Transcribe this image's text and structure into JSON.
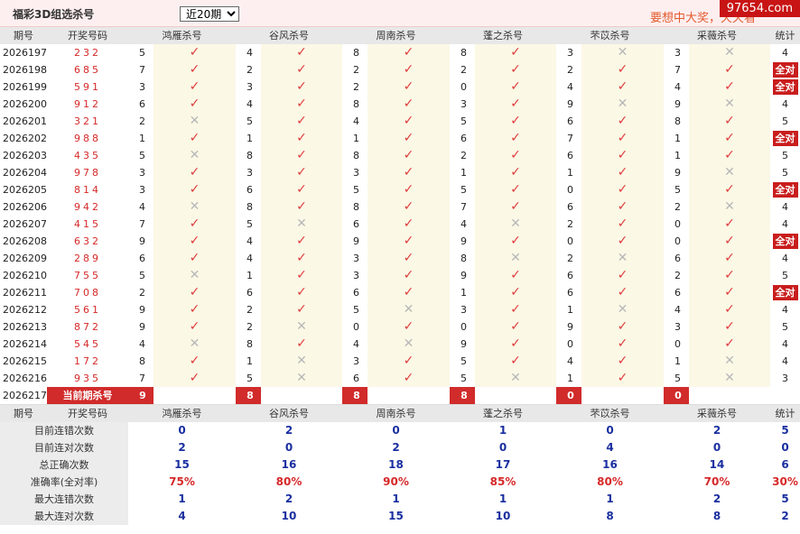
{
  "header": {
    "title": "福彩3D组选杀号",
    "period_select": "近20期",
    "slogan": "要想中大奖，天天看",
    "watermark": "97654.com"
  },
  "columns": {
    "period": "期号",
    "draw": "开奖号码",
    "m1": "鸿雁杀号",
    "m2": "谷风杀号",
    "m3": "周南杀号",
    "m4": "蓬之杀号",
    "m5": "芣苡杀号",
    "m6": "采薇杀号",
    "stat": "统计"
  },
  "icons": {
    "ok": "check-icon",
    "no": "cross-icon"
  },
  "all_correct_label": "全对",
  "rows": [
    {
      "p": "2026197",
      "d": "232",
      "k": [
        "5",
        "4",
        "8",
        "8",
        "3",
        "3"
      ],
      "r": [
        1,
        1,
        1,
        1,
        0,
        0
      ],
      "s": "4"
    },
    {
      "p": "2026198",
      "d": "685",
      "k": [
        "7",
        "2",
        "2",
        "2",
        "2",
        "7"
      ],
      "r": [
        1,
        1,
        1,
        1,
        1,
        1
      ],
      "s": "全对"
    },
    {
      "p": "2026199",
      "d": "591",
      "k": [
        "3",
        "3",
        "2",
        "0",
        "4",
        "4"
      ],
      "r": [
        1,
        1,
        1,
        1,
        1,
        1
      ],
      "s": "全对"
    },
    {
      "p": "2026200",
      "d": "912",
      "k": [
        "6",
        "4",
        "8",
        "3",
        "9",
        "9"
      ],
      "r": [
        1,
        1,
        1,
        1,
        0,
        0
      ],
      "s": "4"
    },
    {
      "p": "2026201",
      "d": "321",
      "k": [
        "2",
        "5",
        "4",
        "5",
        "6",
        "8"
      ],
      "r": [
        0,
        1,
        1,
        1,
        1,
        1
      ],
      "s": "5"
    },
    {
      "p": "2026202",
      "d": "988",
      "k": [
        "1",
        "1",
        "1",
        "6",
        "7",
        "1"
      ],
      "r": [
        1,
        1,
        1,
        1,
        1,
        1
      ],
      "s": "全对"
    },
    {
      "p": "2026203",
      "d": "435",
      "k": [
        "5",
        "8",
        "8",
        "2",
        "6",
        "1"
      ],
      "r": [
        0,
        1,
        1,
        1,
        1,
        1
      ],
      "s": "5"
    },
    {
      "p": "2026204",
      "d": "978",
      "k": [
        "3",
        "3",
        "3",
        "1",
        "1",
        "9"
      ],
      "r": [
        1,
        1,
        1,
        1,
        1,
        0
      ],
      "s": "5"
    },
    {
      "p": "2026205",
      "d": "814",
      "k": [
        "3",
        "6",
        "5",
        "5",
        "0",
        "5"
      ],
      "r": [
        1,
        1,
        1,
        1,
        1,
        1
      ],
      "s": "全对"
    },
    {
      "p": "2026206",
      "d": "942",
      "k": [
        "4",
        "8",
        "8",
        "7",
        "6",
        "2"
      ],
      "r": [
        0,
        1,
        1,
        1,
        1,
        0
      ],
      "s": "4"
    },
    {
      "p": "2026207",
      "d": "415",
      "k": [
        "7",
        "5",
        "6",
        "4",
        "2",
        "0"
      ],
      "r": [
        1,
        0,
        1,
        0,
        1,
        1
      ],
      "s": "4"
    },
    {
      "p": "2026208",
      "d": "632",
      "k": [
        "9",
        "4",
        "9",
        "9",
        "0",
        "0"
      ],
      "r": [
        1,
        1,
        1,
        1,
        1,
        1
      ],
      "s": "全对"
    },
    {
      "p": "2026209",
      "d": "289",
      "k": [
        "6",
        "4",
        "3",
        "8",
        "2",
        "6"
      ],
      "r": [
        1,
        1,
        1,
        0,
        0,
        1
      ],
      "s": "4"
    },
    {
      "p": "2026210",
      "d": "755",
      "k": [
        "5",
        "1",
        "3",
        "9",
        "6",
        "2"
      ],
      "r": [
        0,
        1,
        1,
        1,
        1,
        1
      ],
      "s": "5"
    },
    {
      "p": "2026211",
      "d": "708",
      "k": [
        "2",
        "6",
        "6",
        "1",
        "6",
        "6"
      ],
      "r": [
        1,
        1,
        1,
        1,
        1,
        1
      ],
      "s": "全对"
    },
    {
      "p": "2026212",
      "d": "561",
      "k": [
        "9",
        "2",
        "5",
        "3",
        "1",
        "4"
      ],
      "r": [
        1,
        1,
        0,
        1,
        0,
        1
      ],
      "s": "4"
    },
    {
      "p": "2026213",
      "d": "872",
      "k": [
        "9",
        "2",
        "0",
        "0",
        "9",
        "3"
      ],
      "r": [
        1,
        0,
        1,
        1,
        1,
        1
      ],
      "s": "5"
    },
    {
      "p": "2026214",
      "d": "545",
      "k": [
        "4",
        "8",
        "4",
        "9",
        "0",
        "0"
      ],
      "r": [
        0,
        1,
        0,
        1,
        1,
        1
      ],
      "s": "4"
    },
    {
      "p": "2026215",
      "d": "172",
      "k": [
        "8",
        "1",
        "3",
        "5",
        "4",
        "1"
      ],
      "r": [
        1,
        0,
        1,
        1,
        1,
        0
      ],
      "s": "4"
    },
    {
      "p": "2026216",
      "d": "935",
      "k": [
        "7",
        "5",
        "6",
        "5",
        "1",
        "5"
      ],
      "r": [
        1,
        0,
        1,
        0,
        1,
        0
      ],
      "s": "3"
    }
  ],
  "current": {
    "p": "2026217",
    "label": "当前期杀号",
    "k": [
      "9",
      "8",
      "8",
      "8",
      "0",
      "0"
    ]
  },
  "summary": [
    {
      "label": "目前连错次数",
      "v": [
        "0",
        "2",
        "0",
        "1",
        "0",
        "2",
        "5"
      ],
      "red": false
    },
    {
      "label": "目前连对次数",
      "v": [
        "2",
        "0",
        "2",
        "0",
        "4",
        "0",
        "0"
      ],
      "red": false
    },
    {
      "label": "总正确次数",
      "v": [
        "15",
        "16",
        "18",
        "17",
        "16",
        "14",
        "6"
      ],
      "red": false
    },
    {
      "label": "准确率(全对率)",
      "v": [
        "75%",
        "80%",
        "90%",
        "85%",
        "80%",
        "70%",
        "30%"
      ],
      "red": true
    },
    {
      "label": "最大连错次数",
      "v": [
        "1",
        "2",
        "1",
        "1",
        "1",
        "2",
        "5"
      ],
      "red": false
    },
    {
      "label": "最大连对次数",
      "v": [
        "4",
        "10",
        "15",
        "10",
        "8",
        "8",
        "2"
      ],
      "red": false
    }
  ]
}
